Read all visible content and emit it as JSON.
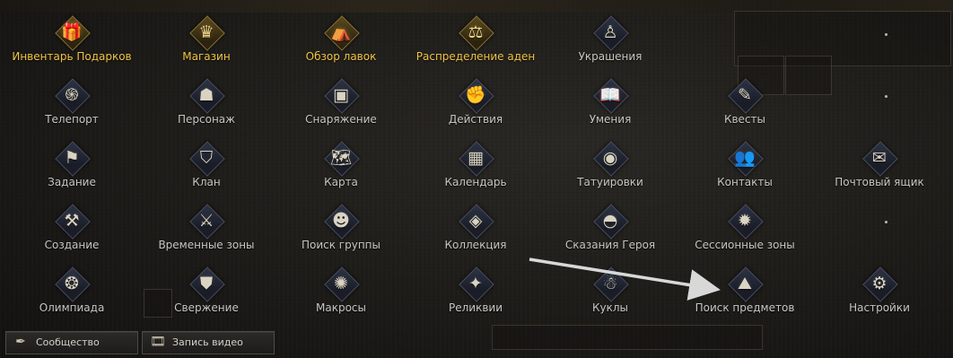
{
  "menu_items": [
    {
      "label": "Инвентарь Подарков",
      "icon": "gift-inventory-icon",
      "glyph": "🎁",
      "highlight": true
    },
    {
      "label": "Магазин",
      "icon": "shop-icon",
      "glyph": "♛",
      "highlight": true
    },
    {
      "label": "Обзор лавок",
      "icon": "stalls-icon",
      "glyph": "⛺",
      "highlight": true
    },
    {
      "label": "Распределение аден",
      "icon": "scales-icon",
      "glyph": "⚖",
      "highlight": true
    },
    {
      "label": "Украшения",
      "icon": "mannequin-icon",
      "glyph": "♙",
      "highlight": false
    },
    {
      "label": "Телепорт",
      "icon": "teleport-icon",
      "glyph": "֍",
      "highlight": false
    },
    {
      "label": "Персонаж",
      "icon": "character-icon",
      "glyph": "☗",
      "highlight": false
    },
    {
      "label": "Снаряжение",
      "icon": "equipment-icon",
      "glyph": "▣",
      "highlight": false
    },
    {
      "label": "Действия",
      "icon": "fist-icon",
      "glyph": "✊",
      "highlight": false
    },
    {
      "label": "Умения",
      "icon": "book-icon",
      "glyph": "📖",
      "highlight": false
    },
    {
      "label": "Квесты",
      "icon": "quest-scroll-icon",
      "glyph": "✎",
      "highlight": false
    },
    {
      "label": "Задание",
      "icon": "task-flag-icon",
      "glyph": "⚑",
      "highlight": false
    },
    {
      "label": "Клан",
      "icon": "clan-shield-icon",
      "glyph": "⛉",
      "highlight": false
    },
    {
      "label": "Карта",
      "icon": "map-icon",
      "glyph": "🗺",
      "highlight": false
    },
    {
      "label": "Календарь",
      "icon": "calendar-icon",
      "glyph": "▦",
      "highlight": false
    },
    {
      "label": "Татуировки",
      "icon": "tattoo-icon",
      "glyph": "◉",
      "highlight": false
    },
    {
      "label": "Контакты",
      "icon": "contacts-icon",
      "glyph": "👥",
      "highlight": false
    },
    {
      "label": "Почтовый ящик",
      "icon": "mailbox-icon",
      "glyph": "✉",
      "highlight": false
    },
    {
      "label": "Создание",
      "icon": "craft-icon",
      "glyph": "⚒",
      "highlight": false
    },
    {
      "label": "Временные зоны",
      "icon": "crossed-swords-icon",
      "glyph": "⚔",
      "highlight": false
    },
    {
      "label": "Поиск группы",
      "icon": "party-search-icon",
      "glyph": "☻",
      "highlight": false
    },
    {
      "label": "Коллекция",
      "icon": "collection-icon",
      "glyph": "◈",
      "highlight": false
    },
    {
      "label": "Сказания Героя",
      "icon": "hero-tales-icon",
      "glyph": "◓",
      "highlight": false
    },
    {
      "label": "Сессионные зоны",
      "icon": "session-zones-icon",
      "glyph": "✹",
      "highlight": false
    },
    {
      "label": "Олимпиада",
      "icon": "olympiad-icon",
      "glyph": "❂",
      "highlight": false
    },
    {
      "label": "Свержение",
      "icon": "overthrow-icon",
      "glyph": "⛊",
      "highlight": false
    },
    {
      "label": "Макросы",
      "icon": "macros-icon",
      "glyph": "✺",
      "highlight": false
    },
    {
      "label": "Реликвии",
      "icon": "relics-icon",
      "glyph": "✦",
      "highlight": false
    },
    {
      "label": "Куклы",
      "icon": "dolls-icon",
      "glyph": "☃",
      "highlight": false
    },
    {
      "label": "Поиск предметов",
      "icon": "item-search-icon",
      "glyph": "⛰",
      "highlight": false
    },
    {
      "label": "Настройки",
      "icon": "settings-icon",
      "glyph": "⚙",
      "highlight": false
    }
  ],
  "bottom_buttons": [
    {
      "label": "Сообщество",
      "icon": "community-quill-icon",
      "glyph": "✒"
    },
    {
      "label": "Запись видео",
      "icon": "video-record-icon",
      "glyph": "🎞"
    }
  ],
  "colors": {
    "highlight_label": "#f2c545",
    "normal_label": "#c8c8c2",
    "arrow": "#d8d8d8"
  }
}
